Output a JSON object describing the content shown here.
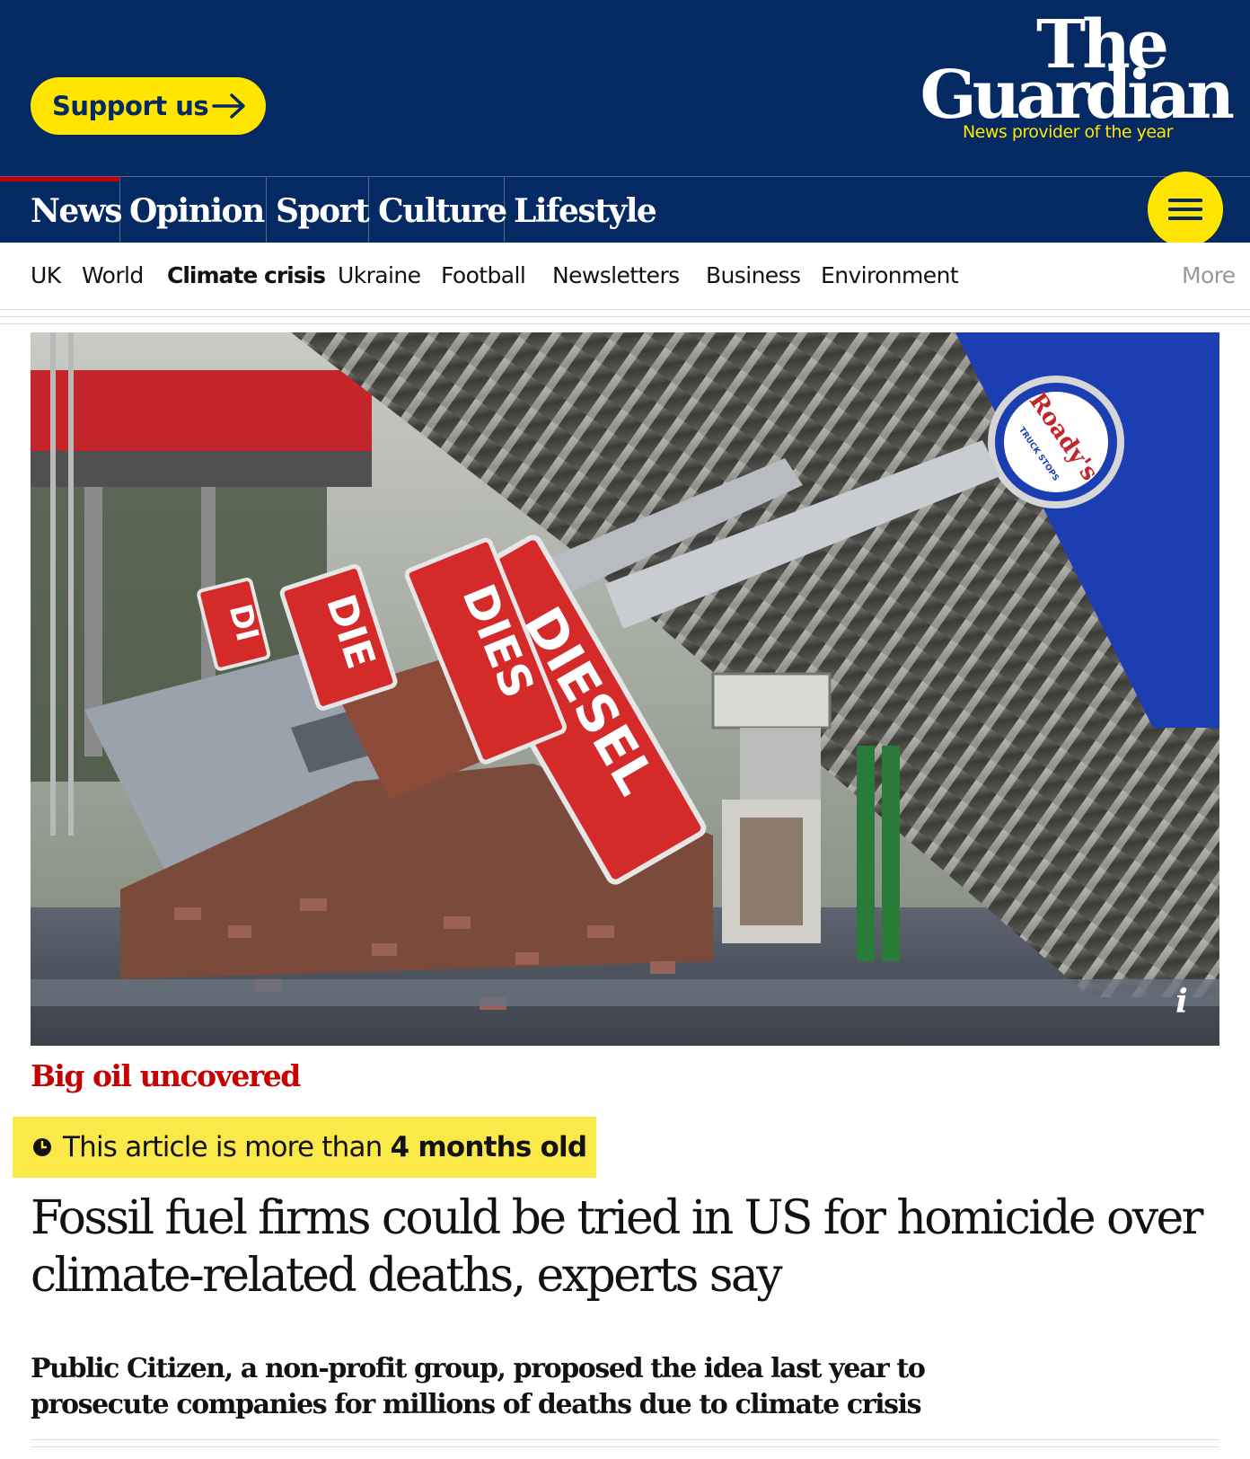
{
  "header": {
    "support_label": "Support us",
    "logo_the": "The",
    "logo_guardian": "Guardian",
    "tagline": "News provider of the year",
    "colors": {
      "brand": "#052962",
      "accent": "#ffe500",
      "news_red": "#c70000"
    }
  },
  "pillars": [
    {
      "label": "News",
      "active": true
    },
    {
      "label": "Opinion",
      "active": false
    },
    {
      "label": "Sport",
      "active": false
    },
    {
      "label": "Culture",
      "active": false
    },
    {
      "label": "Lifestyle",
      "active": false
    }
  ],
  "menu_icon": "hamburger-icon",
  "subnav": {
    "items": [
      "UK",
      "World",
      "Climate crisis",
      "Ukraine",
      "Football",
      "Newsletters",
      "Business",
      "Environment"
    ],
    "selected": "Climate crisis",
    "more_label": "More"
  },
  "hero": {
    "info_icon": "i",
    "sign_text": [
      "DIESEL",
      "DIES",
      "DIE",
      "DI"
    ],
    "logo_text": "Roady's",
    "logo_subtext": "TRUCK STOPS"
  },
  "article": {
    "series": "Big oil uncovered",
    "age_prefix": "This article is more than ",
    "age_strong": "4 months old",
    "headline": "Fossil fuel firms could be tried in US for homicide over climate-related deaths, experts say",
    "standfirst": "Public Citizen, a non-profit group, proposed the idea last year to prosecute companies for millions of deaths due to climate crisis"
  }
}
